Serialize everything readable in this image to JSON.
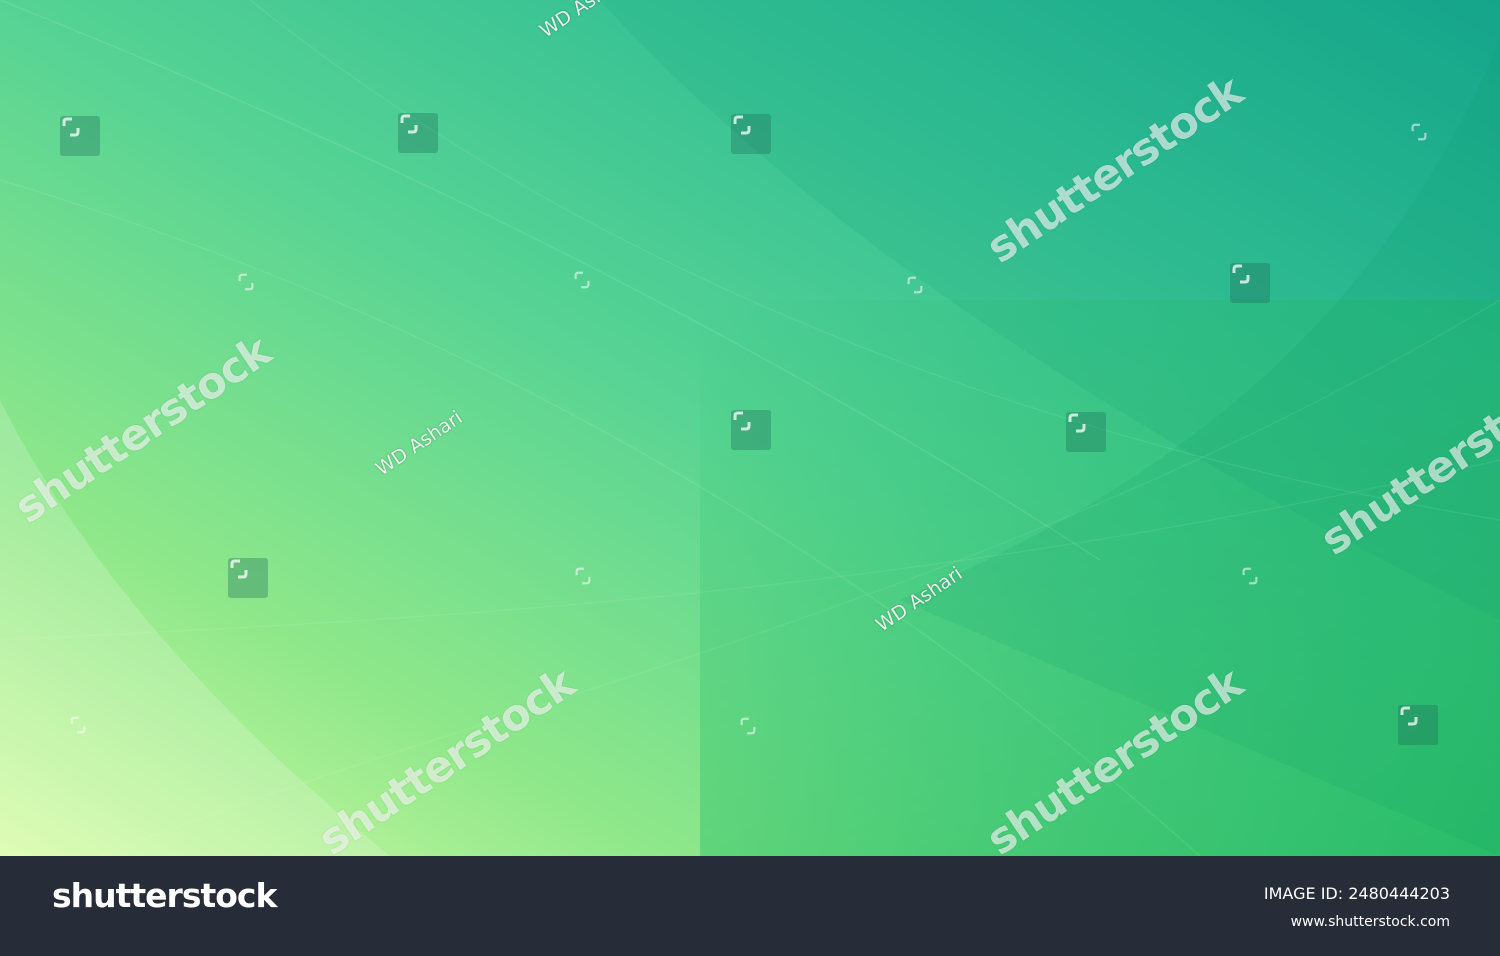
{
  "watermark": {
    "brand_text": "shutterstock",
    "author_text": "WD Ashari"
  },
  "footer": {
    "logo_text": "shutterstock",
    "image_id_text": "IMAGE ID: 2480444203",
    "url_text": "www.shutterstock.com"
  },
  "colors": {
    "gradient_light": "#d8fca6",
    "gradient_mid": "#5fd69a",
    "gradient_dark": "#13a58f",
    "gradient_bottom_right": "#28c06a",
    "footer_bg": "#272d38"
  },
  "icons": {
    "watermark_tile": "shutterstock-mark-icon"
  }
}
